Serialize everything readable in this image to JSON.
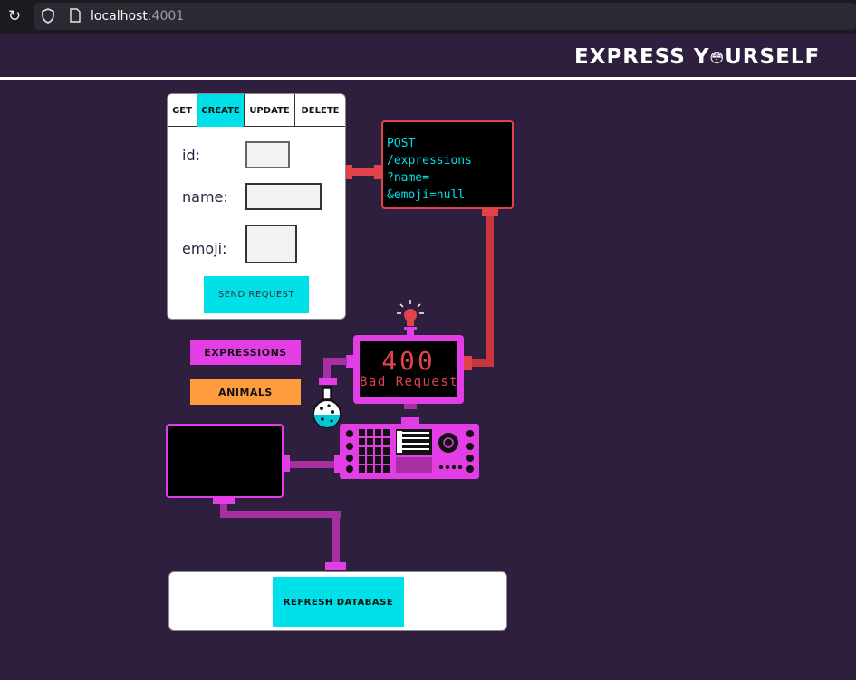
{
  "browser": {
    "url_host": "localhost",
    "url_port": ":4001"
  },
  "header": {
    "brand_left": "EXPRESS Y",
    "brand_emoji": "😳",
    "brand_right": "URSELF"
  },
  "form": {
    "tabs": [
      {
        "label": "GET",
        "active": false
      },
      {
        "label": "CREATE",
        "active": true
      },
      {
        "label": "UPDATE",
        "active": false
      },
      {
        "label": "DELETE",
        "active": false
      }
    ],
    "fields": [
      {
        "label": "id:",
        "value": ""
      },
      {
        "label": "name:",
        "value": ""
      },
      {
        "label": "emoji:",
        "value": ""
      }
    ],
    "send_label": "SEND REQUEST"
  },
  "terminal": {
    "lines": [
      "POST",
      "/expressions",
      "?name=",
      "&emoji=null"
    ]
  },
  "nav": {
    "expressions_label": "EXPRESSIONS",
    "animals_label": "ANIMALS"
  },
  "status": {
    "code": "400",
    "text": "Bad Request"
  },
  "database": {
    "refresh_label": "REFRESH DATABASE"
  },
  "colors": {
    "background": "#2d1f3d",
    "cyan": "#00e0e8",
    "magenta": "#e33ee6",
    "orange": "#ff9c3d",
    "red": "#e0434b",
    "purple_pipe": "#a72ea3"
  }
}
